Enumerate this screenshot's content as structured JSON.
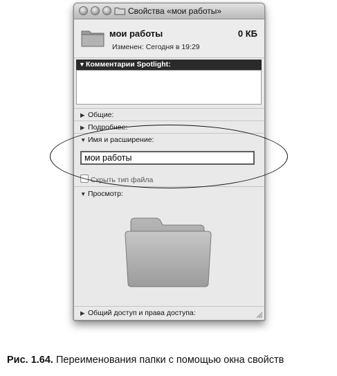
{
  "window": {
    "title": "Свойства «мои работы»"
  },
  "header": {
    "name": "мои работы",
    "size": "0 КБ",
    "modified": "Изменен: Сегодня в 19:29"
  },
  "spotlight": {
    "label": "Комментарии Spotlight:",
    "comment": ""
  },
  "sections": {
    "general": "Общие:",
    "more_info": "Подробнее:",
    "name_ext": "Имя и расширение:",
    "preview": "Просмотр:",
    "sharing": "Общий доступ и права доступа:"
  },
  "name_field": {
    "value": "мои работы"
  },
  "hide_ext": {
    "label": "Скрыть тип файла",
    "checked": false
  },
  "icons": {
    "collapsed": "▶",
    "expanded": "▼"
  },
  "caption": {
    "number": "Рис. 1.64.",
    "text": " Переименования папки с помощью окна свойств"
  }
}
